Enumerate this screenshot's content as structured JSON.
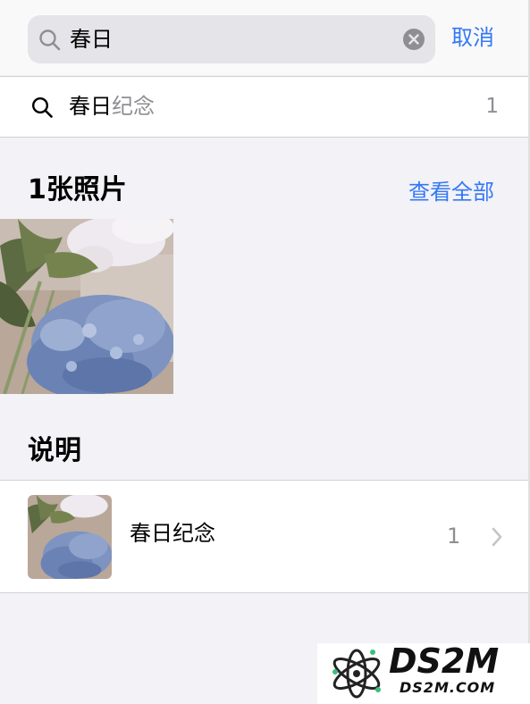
{
  "search": {
    "query": "春日",
    "cancel_label": "取消"
  },
  "suggestion": {
    "match": "春日",
    "rest": "纪念",
    "count": "1"
  },
  "photos_section": {
    "title": "1张照片",
    "see_all_label": "查看全部",
    "photo_count": 1
  },
  "captions_section": {
    "title": "说明",
    "items": [
      {
        "text": "春日纪念",
        "count": "1"
      }
    ]
  },
  "watermark": {
    "brand": "DS2M",
    "url": "DS2M.COM"
  },
  "colors": {
    "accent": "#3478f6",
    "background": "#f2f2f7",
    "secondary_text": "#8e8e93"
  },
  "icons": [
    "search-icon",
    "clear-icon",
    "chevron-right-icon"
  ]
}
